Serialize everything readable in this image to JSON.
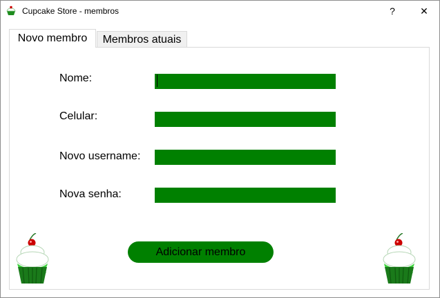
{
  "window": {
    "title": "Cupcake Store - membros",
    "help_label": "?",
    "close_label": "✕"
  },
  "tabs": [
    {
      "label": "Novo membro",
      "active": true
    },
    {
      "label": "Membros atuais",
      "active": false
    }
  ],
  "form": {
    "fields": [
      {
        "label": "Nome:",
        "value": ""
      },
      {
        "label": "Celular:",
        "value": ""
      },
      {
        "label": "Novo username:",
        "value": ""
      },
      {
        "label": "Nova senha:",
        "value": ""
      }
    ],
    "submit_label": "Adicionar membro"
  },
  "colors": {
    "accent": "#008000",
    "cupcake_frosting": "#ffffff",
    "cupcake_cherry": "#cc0000"
  },
  "icons": {
    "app": "cupcake-icon",
    "decor_left": "cupcake-icon",
    "decor_right": "cupcake-icon"
  }
}
